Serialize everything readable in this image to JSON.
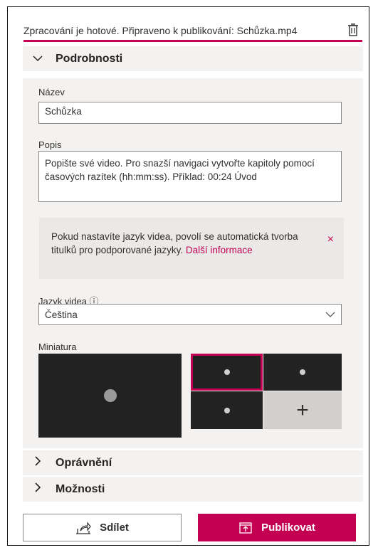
{
  "status": {
    "text": "Zpracování je hotové. Připraveno k publikování: Schůzka.mp4",
    "delete_icon": "trash-icon"
  },
  "sections": {
    "details": {
      "label": "Podrobnosti",
      "expanded": true,
      "chevron_icon": "chevron-down-icon"
    },
    "permissions": {
      "label": "Oprávnění",
      "expanded": false,
      "chevron_icon": "chevron-right-icon"
    },
    "options": {
      "label": "Možnosti",
      "expanded": false,
      "chevron_icon": "chevron-right-icon"
    }
  },
  "details": {
    "name_label": "Název",
    "name_value": "Schůzka",
    "description_label": "Popis",
    "description_value": "Popište své video. Pro snazší navigaci vytvořte kapitoly pomocí časových razítek (hh:mm:ss). Příklad: 00:24 Úvod",
    "info": {
      "text": "Pokud nastavíte jazyk videa, povolí se automatická tvorba titulků pro podporované jazyky.",
      "link": "Další informace",
      "close_glyph": "×"
    },
    "language_label": "Jazyk videa",
    "language_info_glyph": "ⓘ",
    "language_value": "Čeština",
    "thumbnail_label": "Miniatura",
    "add_thumbnail_glyph": "+"
  },
  "actions": {
    "share_label": "Sdílet",
    "publish_label": "Publikovat"
  },
  "colors": {
    "accent": "#c30052",
    "panel": "#f3f2f1"
  }
}
